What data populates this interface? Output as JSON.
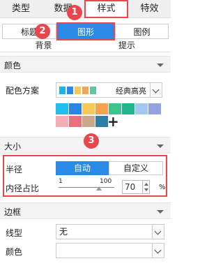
{
  "tabs": [
    "类型",
    "数据",
    "样式",
    "特效"
  ],
  "subtabs_row1": [
    "标题",
    "图形",
    "图例"
  ],
  "subtabs_row2": [
    "背景",
    "提示"
  ],
  "badges": [
    "1",
    "2",
    "3"
  ],
  "sections": {
    "color": "颜色",
    "size": "大小",
    "border": "边框"
  },
  "color": {
    "scheme_label": "配色方案",
    "scheme_name": "经典高亮",
    "palette_swatches": [
      "#1fb2e8",
      "#2a8be6",
      "#f7c75e",
      "#f2a65a",
      "#5ec8a0"
    ],
    "grid_colors": [
      "#1fc0f0",
      "#2a86e0",
      "#f8c85a",
      "#f6a24f",
      "#40c48e",
      "#20b58a",
      "#a4c8f2",
      "#94a3e0",
      "#f6aeb6",
      "#e9707c",
      "#c9a98a",
      "#2f7ea6"
    ],
    "add_symbol": "+"
  },
  "size": {
    "radius_label": "半径",
    "radius_options": [
      "自动",
      "自定义"
    ],
    "inner_ratio_label": "内径占比",
    "slider_min": "1",
    "slider_max": "100",
    "inner_ratio_value": "70",
    "unit": "%"
  },
  "border": {
    "line_type_label": "线型",
    "line_type_value": "无",
    "color_label": "颜色"
  }
}
